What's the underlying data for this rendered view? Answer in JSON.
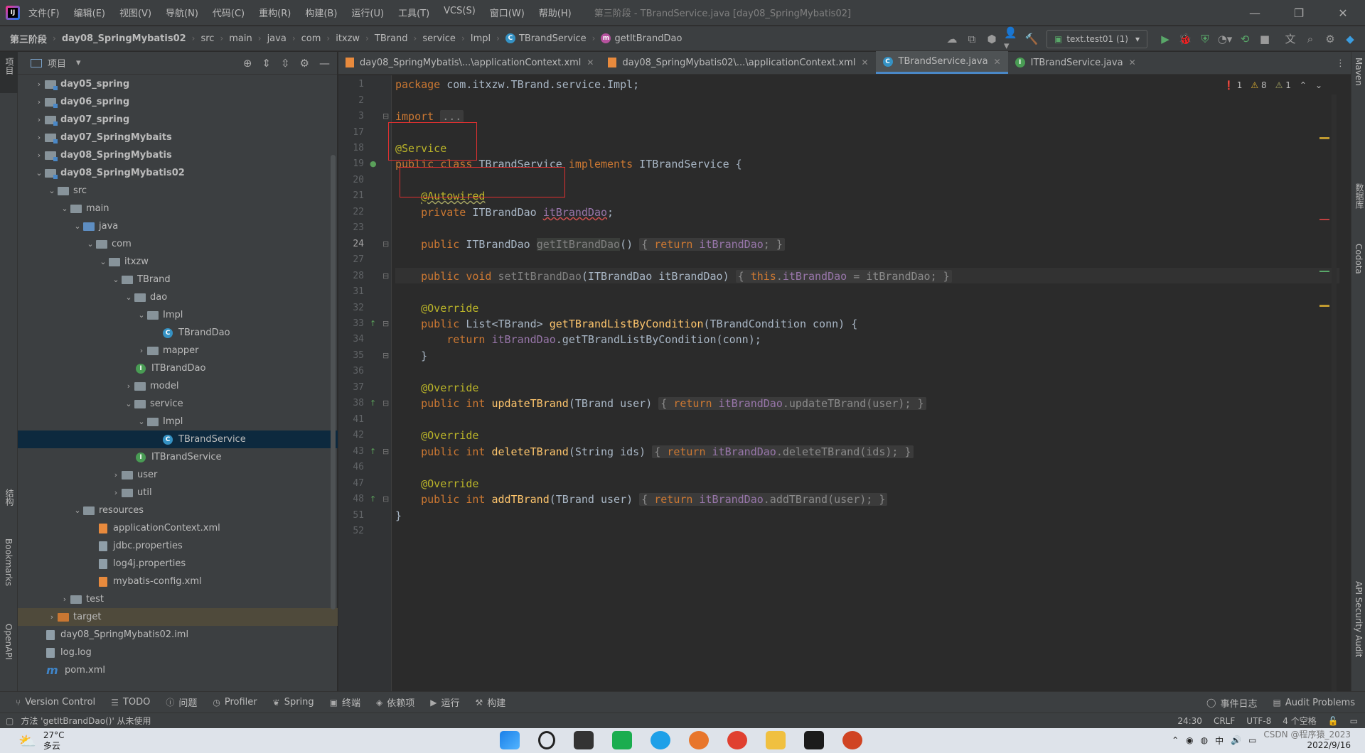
{
  "menu": [
    "文件(F)",
    "编辑(E)",
    "视图(V)",
    "导航(N)",
    "代码(C)",
    "重构(R)",
    "构建(B)",
    "运行(U)",
    "工具(T)",
    "VCS(S)",
    "窗口(W)",
    "帮助(H)"
  ],
  "window_title": "第三阶段 - TBrandService.java [day08_SpringMybatis02]",
  "breadcrumbs": [
    "第三阶段",
    "day08_SpringMybatis02",
    "src",
    "main",
    "java",
    "com",
    "itxzw",
    "TBrand",
    "service",
    "Impl",
    "TBrandService",
    "getItBrandDao"
  ],
  "run_config": "text.test01 (1)",
  "project_panel": {
    "title": "项目",
    "tree": [
      {
        "label": "day05_spring",
        "indent": 1,
        "arrow": "›",
        "icon": "module",
        "bold": true
      },
      {
        "label": "day06_spring",
        "indent": 1,
        "arrow": "›",
        "icon": "module",
        "bold": true
      },
      {
        "label": "day07_spring",
        "indent": 1,
        "arrow": "›",
        "icon": "module",
        "bold": true
      },
      {
        "label": "day07_SpringMybaits",
        "indent": 1,
        "arrow": "›",
        "icon": "module",
        "bold": true
      },
      {
        "label": "day08_SpringMybatis",
        "indent": 1,
        "arrow": "›",
        "icon": "module",
        "bold": true
      },
      {
        "label": "day08_SpringMybatis02",
        "indent": 1,
        "arrow": "⌄",
        "icon": "module",
        "bold": true
      },
      {
        "label": "src",
        "indent": 2,
        "arrow": "⌄",
        "icon": "folder"
      },
      {
        "label": "main",
        "indent": 3,
        "arrow": "⌄",
        "icon": "folder"
      },
      {
        "label": "java",
        "indent": 4,
        "arrow": "⌄",
        "icon": "blue"
      },
      {
        "label": "com",
        "indent": 5,
        "arrow": "⌄",
        "icon": "folder"
      },
      {
        "label": "itxzw",
        "indent": 6,
        "arrow": "⌄",
        "icon": "folder"
      },
      {
        "label": "TBrand",
        "indent": 7,
        "arrow": "⌄",
        "icon": "folder"
      },
      {
        "label": "dao",
        "indent": 8,
        "arrow": "⌄",
        "icon": "folder"
      },
      {
        "label": "Impl",
        "indent": 9,
        "arrow": "⌄",
        "icon": "folder"
      },
      {
        "label": "TBrandDao",
        "indent": 10,
        "arrow": "",
        "icon": "class"
      },
      {
        "label": "mapper",
        "indent": 9,
        "arrow": "›",
        "icon": "folder"
      },
      {
        "label": "ITBrandDao",
        "indent": 9,
        "arrow": "",
        "icon": "interface",
        "shift": true
      },
      {
        "label": "model",
        "indent": 8,
        "arrow": "›",
        "icon": "folder"
      },
      {
        "label": "service",
        "indent": 8,
        "arrow": "⌄",
        "icon": "folder"
      },
      {
        "label": "Impl",
        "indent": 9,
        "arrow": "⌄",
        "icon": "folder"
      },
      {
        "label": "TBrandService",
        "indent": 10,
        "arrow": "",
        "icon": "class",
        "selected": true
      },
      {
        "label": "ITBrandService",
        "indent": 9,
        "arrow": "",
        "icon": "interface",
        "shift": true
      },
      {
        "label": "user",
        "indent": 7,
        "arrow": "›",
        "icon": "folder"
      },
      {
        "label": "util",
        "indent": 7,
        "arrow": "›",
        "icon": "folder"
      },
      {
        "label": "resources",
        "indent": 4,
        "arrow": "⌄",
        "icon": "folder"
      },
      {
        "label": "applicationContext.xml",
        "indent": 5,
        "arrow": "",
        "icon": "xml"
      },
      {
        "label": "jdbc.properties",
        "indent": 5,
        "arrow": "",
        "icon": "file"
      },
      {
        "label": "log4j.properties",
        "indent": 5,
        "arrow": "",
        "icon": "file"
      },
      {
        "label": "mybatis-config.xml",
        "indent": 5,
        "arrow": "",
        "icon": "xml"
      },
      {
        "label": "test",
        "indent": 3,
        "arrow": "›",
        "icon": "folder"
      },
      {
        "label": "target",
        "indent": 2,
        "arrow": "›",
        "icon": "orange",
        "excluded": true
      },
      {
        "label": "day08_SpringMybatis02.iml",
        "indent": 2,
        "arrow": "",
        "icon": "file",
        "shift": true
      },
      {
        "label": "log.log",
        "indent": 2,
        "arrow": "",
        "icon": "file",
        "shift": true
      },
      {
        "label": "pom.xml",
        "indent": 2,
        "arrow": "",
        "icon": "maven",
        "shift": true
      }
    ]
  },
  "tabs": [
    {
      "label": "day08_SpringMybatis\\...\\applicationContext.xml",
      "icon": "xml"
    },
    {
      "label": "day08_SpringMybatis02\\...\\applicationContext.xml",
      "icon": "xml"
    },
    {
      "label": "TBrandService.java",
      "icon": "class",
      "active": true
    },
    {
      "label": "ITBrandService.java",
      "icon": "interface"
    }
  ],
  "inspections": {
    "errors": "1",
    "warnings": "8",
    "weak": "1"
  },
  "line_numbers": [
    "1",
    "2",
    "3",
    "17",
    "18",
    "19",
    "20",
    "21",
    "22",
    "23",
    "24",
    "27",
    "28",
    "31",
    "32",
    "33",
    "34",
    "35",
    "36",
    "37",
    "38",
    "41",
    "42",
    "43",
    "46",
    "47",
    "48",
    "51",
    "52"
  ],
  "left_strip": {
    "project": "项目",
    "structure": "结构",
    "bookmarks": "Bookmarks",
    "openapi": "OpenAPI"
  },
  "right_strip": {
    "maven": "Maven",
    "database": "数据库",
    "codota": "Codota",
    "api_audit": "API Security Audit"
  },
  "bottom_tools": [
    "Version Control",
    "TODO",
    "问题",
    "Profiler",
    "Spring",
    "终端",
    "依赖项",
    "运行",
    "构建"
  ],
  "bottom_right": [
    "事件日志",
    "Audit Problems"
  ],
  "status": {
    "message": "方法 'getItBrandDao()' 从未使用",
    "position": "24:30",
    "line_sep": "CRLF",
    "encoding": "UTF-8",
    "indent": "4 个空格"
  },
  "taskbar": {
    "weather_temp": "27°C",
    "weather_desc": "多云",
    "date": "2022/9/16",
    "watermark": "CSDN @程序猿_2023"
  }
}
